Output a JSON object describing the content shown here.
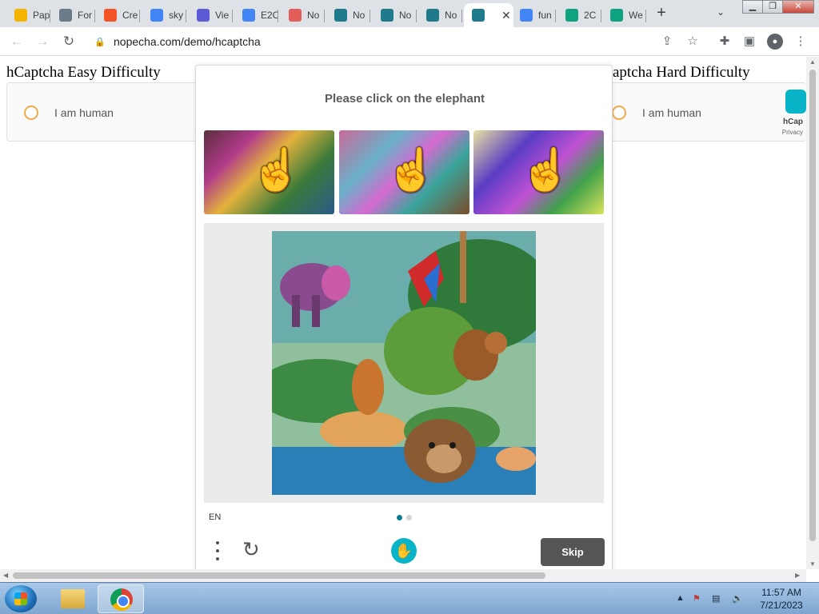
{
  "browser": {
    "tabs": [
      {
        "label": "Pap",
        "icon": "pac-icon",
        "color": "#f5b400"
      },
      {
        "label": "For",
        "icon": "bounty-icon",
        "color": "#6d7a88"
      },
      {
        "label": "Cre",
        "icon": "windows-icon",
        "color": "#f35325"
      },
      {
        "label": "sky",
        "icon": "google-icon",
        "color": "#4285f4"
      },
      {
        "label": "Vie",
        "icon": "at-icon",
        "color": "#5b5bd6"
      },
      {
        "label": "E2C",
        "icon": "google-icon",
        "color": "#4285f4"
      },
      {
        "label": "No",
        "icon": "rainbow-icon",
        "color": "#e35d5b"
      },
      {
        "label": "No",
        "icon": "nopecha-icon",
        "color": "#1f7a8c"
      },
      {
        "label": "No",
        "icon": "nopecha-icon",
        "color": "#1f7a8c"
      },
      {
        "label": "No",
        "icon": "nopecha-icon",
        "color": "#1f7a8c"
      },
      {
        "label": "",
        "icon": "nopecha-icon",
        "color": "#1f7a8c",
        "active": true
      },
      {
        "label": "fun",
        "icon": "google-icon",
        "color": "#4285f4"
      },
      {
        "label": "2C",
        "icon": "openai-icon",
        "color": "#10a37f"
      },
      {
        "label": "We",
        "icon": "openai-icon",
        "color": "#10a37f"
      }
    ],
    "active_tab_close": "✕",
    "new_tab": "+",
    "url": "nopecha.com/demo/hcaptcha"
  },
  "page": {
    "easy": {
      "heading": "hCaptcha Easy Difficulty",
      "checkbox_label": "I am human"
    },
    "hard": {
      "heading": "aptcha Hard Difficulty",
      "checkbox_label": "I am human",
      "brand": "hCap",
      "privacy": "Privacy"
    }
  },
  "challenge": {
    "prompt": "Please click on the elephant",
    "language": "EN",
    "skip_label": "Skip",
    "pager": {
      "total": 2,
      "current": 1
    }
  },
  "taskbar": {
    "time": "11:57 AM",
    "date": "7/21/2023"
  }
}
